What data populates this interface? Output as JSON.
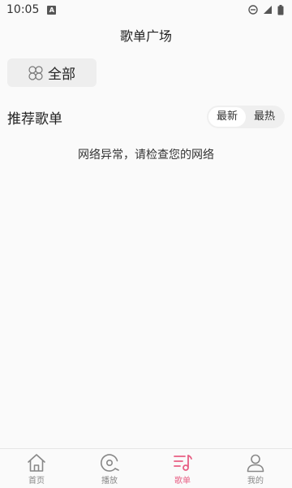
{
  "status_bar": {
    "time": "10:05",
    "a_icon": "A"
  },
  "header": {
    "title": "歌单广场"
  },
  "filter": {
    "label": "全部",
    "icon": "four-leaf-icon"
  },
  "section": {
    "title": "推荐歌单",
    "sort_options": [
      {
        "label": "最新",
        "active": true
      },
      {
        "label": "最热",
        "active": false
      }
    ]
  },
  "main": {
    "message": "网络异常，请检查您的网络"
  },
  "bottom_nav": {
    "items": [
      {
        "label": "首页",
        "icon": "home-icon",
        "active": false
      },
      {
        "label": "播放",
        "icon": "disc-icon",
        "active": false
      },
      {
        "label": "歌单",
        "icon": "playlist-icon",
        "active": true
      },
      {
        "label": "我的",
        "icon": "user-icon",
        "active": false
      }
    ]
  },
  "colors": {
    "accent": "#e75f84",
    "inactive": "#888888",
    "background": "#fafafa"
  }
}
